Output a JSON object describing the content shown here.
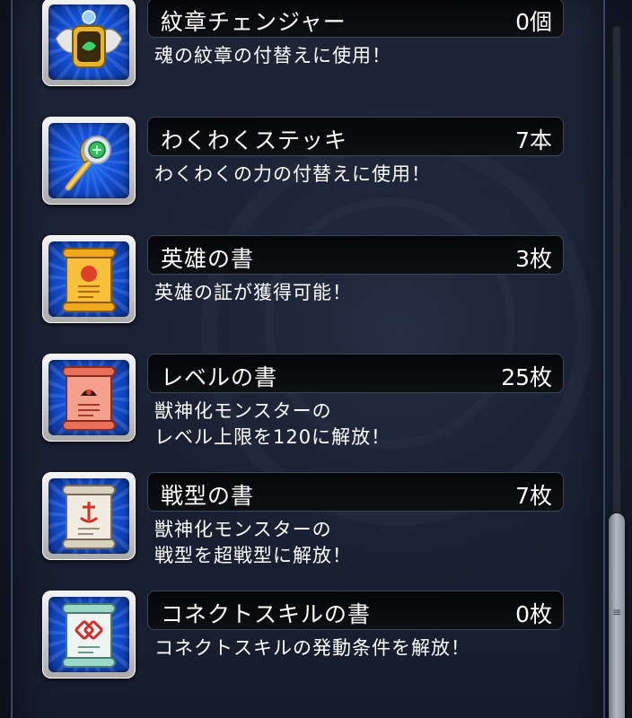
{
  "items": [
    {
      "name": "紋章チェンジャー",
      "count": "0個",
      "desc": "魂の紋章の付替えに使用！",
      "icon": "emblem-changer-icon"
    },
    {
      "name": "わくわくステッキ",
      "count": "7本",
      "desc": "わくわくの力の付替えに使用！",
      "icon": "wakuwaku-stick-icon"
    },
    {
      "name": "英雄の書",
      "count": "3枚",
      "desc": "英雄の証が獲得可能！",
      "icon": "hero-scroll-icon"
    },
    {
      "name": "レベルの書",
      "count": "25枚",
      "desc": "獣神化モンスターの\nレベル上限を120に解放！",
      "icon": "level-scroll-icon"
    },
    {
      "name": "戦型の書",
      "count": "7枚",
      "desc": "獣神化モンスターの\n戦型を超戦型に解放！",
      "icon": "battle-type-scroll-icon"
    },
    {
      "name": "コネクトスキルの書",
      "count": "0枚",
      "desc": "コネクトスキルの発動条件を解放！",
      "icon": "connect-skill-scroll-icon"
    }
  ],
  "colors": {
    "icon_bg": "#1452d8",
    "name_bar": "#050607",
    "text": "#ffffff"
  }
}
